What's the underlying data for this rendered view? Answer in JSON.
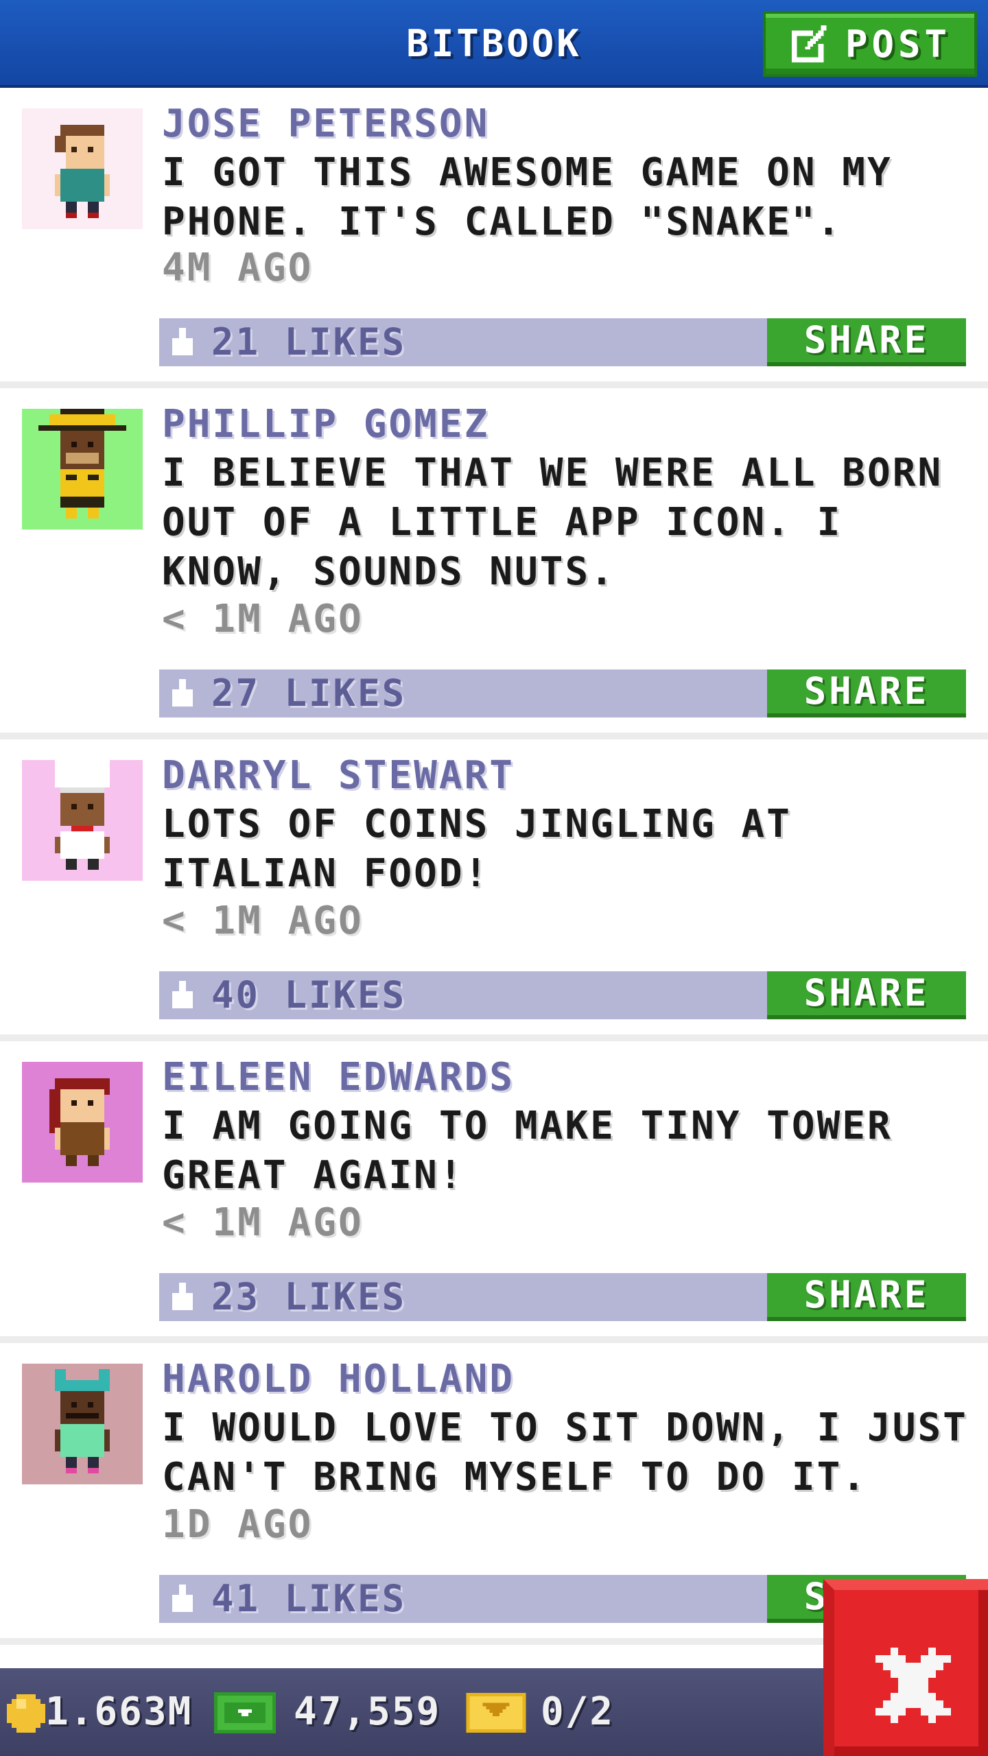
{
  "header": {
    "title": "BITBOOK",
    "post_label": "POST"
  },
  "posts": [
    {
      "name": "JOSE PETERSON",
      "text": "I GOT THIS AWESOME GAME ON MY PHONE. IT'S CALLED \"SNAKE\".",
      "time": "4M AGO",
      "likes": "21 LIKES",
      "share": "SHARE",
      "avatar": "boy-teal-shirt-icon",
      "avatar_bg": "#fcecf4"
    },
    {
      "name": "PHILLIP GOMEZ",
      "text": "I BELIEVE THAT WE WERE ALL BORN OUT OF A LITTLE APP ICON. I KNOW, SOUNDS NUTS.",
      "time": "< 1M AGO",
      "likes": "27 LIKES",
      "share": "SHARE",
      "avatar": "man-yellow-hat-icon",
      "avatar_bg": "#8ef281"
    },
    {
      "name": "DARRYL STEWART",
      "text": "LOTS OF COINS JINGLING AT ITALIAN FOOD!",
      "time": "< 1M AGO",
      "likes": "40 LIKES",
      "share": "SHARE",
      "avatar": "chef-icon",
      "avatar_bg": "#f7c2ee"
    },
    {
      "name": "EILEEN EDWARDS",
      "text": "I AM GOING TO MAKE TINY TOWER GREAT AGAIN!",
      "time": "< 1M AGO",
      "likes": "23 LIKES",
      "share": "SHARE",
      "avatar": "woman-red-hair-icon",
      "avatar_bg": "#de82d6"
    },
    {
      "name": "HAROLD HOLLAND",
      "text": "I WOULD LOVE TO SIT DOWN, I JUST CAN'T BRING MYSELF TO DO IT.",
      "time": "1D AGO",
      "likes": "41 LIKES",
      "share": "SHARE",
      "avatar": "man-cat-ears-icon",
      "avatar_bg": "#cfa0a6"
    }
  ],
  "status": {
    "coins": "1.663M",
    "bux": "47,559",
    "tickets": "0/2"
  },
  "colors": {
    "header_blue": "#1a52b3",
    "accent_green": "#3aa52f",
    "likes_bar": "#b5b5d6",
    "name_purple": "#6a6aa5",
    "close_red": "#e4262a"
  }
}
